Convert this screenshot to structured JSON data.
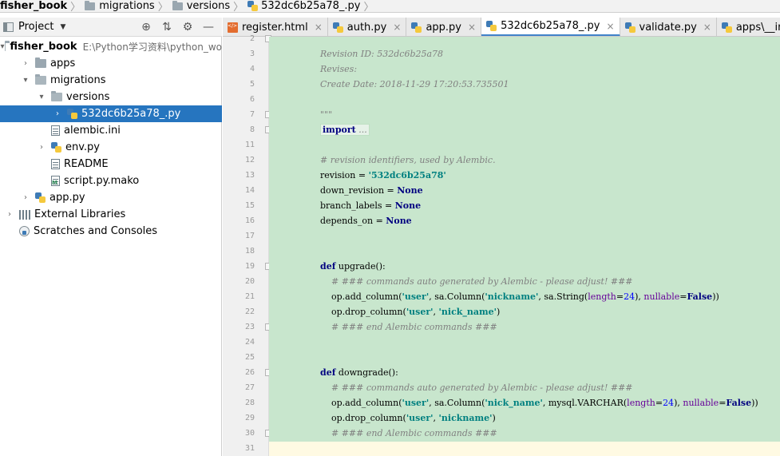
{
  "breadcrumb": {
    "items": [
      "fisher_book",
      "migrations",
      "versions",
      "532dc6b25a78_.py"
    ],
    "separator": "〉"
  },
  "project_panel": {
    "title": "Project",
    "caret": "▼",
    "tools": {
      "target": "⊕",
      "collapse": "⇅",
      "settings": "⚙",
      "hide": "—"
    }
  },
  "tree": [
    {
      "label": "fisher_book",
      "path": "E:\\Python学习资料\\python_wo",
      "depth": 0,
      "arrow": "▾",
      "icon": "folder-open-icon",
      "bold": true
    },
    {
      "label": "apps",
      "depth": 1,
      "arrow": "›",
      "icon": "folder-icon"
    },
    {
      "label": "migrations",
      "depth": 1,
      "arrow": "▾",
      "icon": "folder-open-icon"
    },
    {
      "label": "versions",
      "depth": 2,
      "arrow": "▾",
      "icon": "folder-open-icon"
    },
    {
      "label": "532dc6b25a78_.py",
      "depth": 3,
      "arrow": "›",
      "icon": "python-file-icon",
      "selected": true
    },
    {
      "label": "alembic.ini",
      "depth": 2,
      "arrow": "",
      "icon": "text-file-icon"
    },
    {
      "label": "env.py",
      "depth": 2,
      "arrow": "›",
      "icon": "python-file-icon"
    },
    {
      "label": "README",
      "depth": 2,
      "arrow": "",
      "icon": "text-file-icon"
    },
    {
      "label": "script.py.mako",
      "depth": 2,
      "arrow": "",
      "icon": "mako-file-icon"
    },
    {
      "label": "app.py",
      "depth": 1,
      "arrow": "›",
      "icon": "python-file-icon"
    },
    {
      "label": "External Libraries",
      "depth": 0,
      "arrow": "›",
      "icon": "library-icon"
    },
    {
      "label": "Scratches and Consoles",
      "depth": 0,
      "arrow": "",
      "icon": "scratch-icon"
    }
  ],
  "tabs": [
    {
      "label": "register.html",
      "icon": "html-file-icon",
      "close": "×"
    },
    {
      "label": "auth.py",
      "icon": "python-file-icon",
      "close": "×"
    },
    {
      "label": "app.py",
      "icon": "python-file-icon",
      "close": "×"
    },
    {
      "label": "532dc6b25a78_.py",
      "icon": "python-file-icon",
      "close": "×",
      "active": true
    },
    {
      "label": "validate.py",
      "icon": "python-file-icon",
      "close": "×"
    },
    {
      "label": "apps\\__init__.py",
      "icon": "python-file-icon",
      "close": "×"
    }
  ],
  "editor": {
    "lines": [
      {
        "n": "2",
        "text": ""
      },
      {
        "n": "3",
        "text": "Revision ID: 532dc6b25a78"
      },
      {
        "n": "4",
        "text": "Revises:"
      },
      {
        "n": "5",
        "text": "Create Date: 2018-11-29 17:20:53.735501"
      },
      {
        "n": "6",
        "text": ""
      },
      {
        "n": "7",
        "text": "\"\"\""
      },
      {
        "n": "8",
        "text": "import ..."
      },
      {
        "n": "11",
        "text": ""
      },
      {
        "n": "12",
        "text": "# revision identifiers, used by Alembic."
      },
      {
        "n": "13",
        "text": "revision = '532dc6b25a78'"
      },
      {
        "n": "14",
        "text": "down_revision = None"
      },
      {
        "n": "15",
        "text": "branch_labels = None"
      },
      {
        "n": "16",
        "text": "depends_on = None"
      },
      {
        "n": "17",
        "text": ""
      },
      {
        "n": "18",
        "text": ""
      },
      {
        "n": "19",
        "text": "def upgrade():"
      },
      {
        "n": "20",
        "text": "    # ### commands auto generated by Alembic - please adjust! ###"
      },
      {
        "n": "21",
        "text": "    op.add_column('user', sa.Column('nickname', sa.String(length=24), nullable=False))"
      },
      {
        "n": "22",
        "text": "    op.drop_column('user', 'nick_name')"
      },
      {
        "n": "23",
        "text": "    # ### end Alembic commands ###"
      },
      {
        "n": "24",
        "text": ""
      },
      {
        "n": "25",
        "text": ""
      },
      {
        "n": "26",
        "text": "def downgrade():"
      },
      {
        "n": "27",
        "text": "    # ### commands auto generated by Alembic - please adjust! ###"
      },
      {
        "n": "28",
        "text": "    op.add_column('user', sa.Column('nick_name', mysql.VARCHAR(length=24), nullable=False))"
      },
      {
        "n": "29",
        "text": "    op.drop_column('user', 'nickname')"
      },
      {
        "n": "30",
        "text": "    # ### end Alembic commands ###"
      },
      {
        "n": "31",
        "text": ""
      }
    ]
  },
  "colors": {
    "selection": "#2675bf",
    "diff_background": "#c8e6cd",
    "comment": "#808080",
    "string": "#008080",
    "keyword": "#000080",
    "number": "#0000ff",
    "current_line": "#fffae3"
  }
}
